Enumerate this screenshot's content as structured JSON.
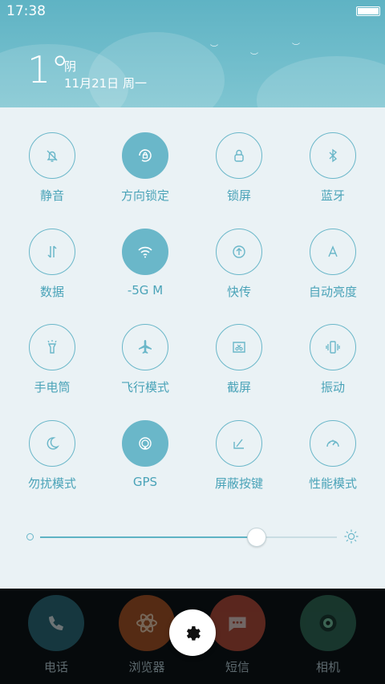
{
  "status": {
    "time": "17:38"
  },
  "weather": {
    "temperature": "1°",
    "condition": "阴",
    "date": "11月21日 周一"
  },
  "tiles": [
    {
      "label": "静音",
      "icon": "bell-off-icon",
      "active": false
    },
    {
      "label": "方向锁定",
      "icon": "rotation-lock-icon",
      "active": true
    },
    {
      "label": "锁屏",
      "icon": "lock-icon",
      "active": false
    },
    {
      "label": "蓝牙",
      "icon": "bluetooth-icon",
      "active": false
    },
    {
      "label": "数据",
      "icon": "data-arrows-icon",
      "active": false
    },
    {
      "label": "-5G    M",
      "icon": "wifi-icon",
      "active": true
    },
    {
      "label": "快传",
      "icon": "upload-icon",
      "active": false
    },
    {
      "label": "自动亮度",
      "icon": "auto-brightness-icon",
      "active": false
    },
    {
      "label": "手电筒",
      "icon": "flashlight-icon",
      "active": false
    },
    {
      "label": "飞行模式",
      "icon": "airplane-icon",
      "active": false
    },
    {
      "label": "截屏",
      "icon": "screenshot-icon",
      "active": false
    },
    {
      "label": "振动",
      "icon": "vibrate-icon",
      "active": false
    },
    {
      "label": "勿扰模式",
      "icon": "moon-icon",
      "active": false
    },
    {
      "label": "GPS",
      "icon": "gps-icon",
      "active": true
    },
    {
      "label": "屏蔽按键",
      "icon": "block-keys-icon",
      "active": false
    },
    {
      "label": "性能模式",
      "icon": "speedometer-icon",
      "active": false
    }
  ],
  "brightness": {
    "level": 0.73
  },
  "dock": [
    {
      "label": "电话",
      "icon": "phone-icon",
      "color": "#2a6f7e"
    },
    {
      "label": "浏览器",
      "icon": "browser-atom-icon",
      "color": "#b5531e"
    },
    {
      "label": "短信",
      "icon": "message-icon",
      "color": "#c14a35"
    },
    {
      "label": "相机",
      "icon": "camera-icon",
      "color": "#2f6c55"
    }
  ],
  "colors": {
    "accent": "#6ab7c9",
    "header": "#6ab9ca",
    "panel": "#eaf2f5"
  }
}
